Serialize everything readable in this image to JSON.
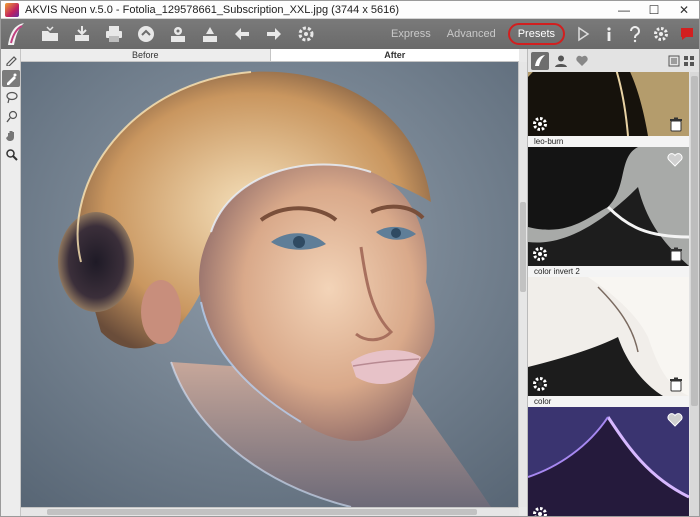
{
  "window": {
    "title": "AKVIS Neon v.5.0 - Fotolia_129578661_Subscription_XXL.jpg (3744 x 5616)",
    "minimize_glyph": "—",
    "maximize_glyph": "☐",
    "close_glyph": "✕"
  },
  "toolbar": {
    "buttons": [
      "open-icon",
      "save-icon",
      "print-icon",
      "share-icon",
      "batch-icon",
      "plugin-icon",
      "undo-icon",
      "redo-icon",
      "settings-cog-icon"
    ],
    "modes": [
      "Express",
      "Advanced",
      "Presets"
    ],
    "active_mode": "Presets",
    "right_icons": [
      "run-icon",
      "info-icon",
      "help-icon",
      "preferences-icon",
      "feedback-icon"
    ]
  },
  "tools": [
    "brush-icon",
    "tube-icon",
    "lasso-icon",
    "eraser-icon",
    "hand-icon",
    "zoom-icon"
  ],
  "view": {
    "before_label": "Before",
    "after_label": "After"
  },
  "panel": {
    "tabs": [
      "akvis-presets-icon",
      "user-presets-icon",
      "favorites-icon"
    ],
    "presets": [
      {
        "label": "leo-burn",
        "style": "warm"
      },
      {
        "label": "color invert 2",
        "style": "gray"
      },
      {
        "label": "color",
        "style": "light"
      },
      {
        "label": "",
        "style": "purple"
      }
    ]
  },
  "colors": {
    "accent_red": "#d21f1f",
    "toolbar_bg": "#6e6e6e",
    "active_mode_text": "#ffffff"
  }
}
